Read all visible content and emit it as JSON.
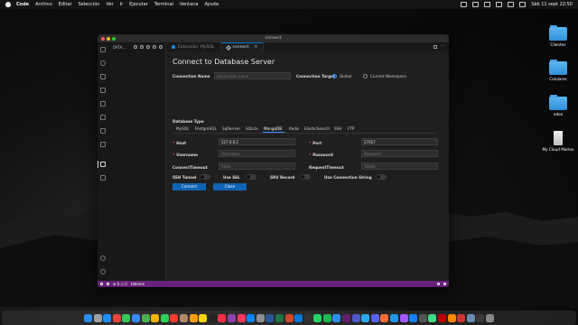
{
  "menubar": {
    "app": "Code",
    "items": [
      "Archivo",
      "Editar",
      "Selección",
      "Ver",
      "Ir",
      "Ejecutar",
      "Terminal",
      "Ventana",
      "Ayuda"
    ],
    "clock": "Sáb 11 sept 22:50"
  },
  "desktop": {
    "icons": [
      "Clientes",
      "Celulares",
      "odoo",
      "My Cloud Marlon"
    ]
  },
  "window": {
    "title": "connect",
    "sidebar_title": "DATA...",
    "tabs": [
      {
        "label": "Extensión: MySQL",
        "active": false
      },
      {
        "label": "connect",
        "active": true
      }
    ]
  },
  "form": {
    "title": "Connect to Database Server",
    "connection_name_label": "Connection Name",
    "connection_name_placeholder": "Connection name",
    "connection_target_label": "Connection Target",
    "target_options": [
      {
        "label": "Global",
        "selected": true
      },
      {
        "label": "Current Workspace",
        "selected": false
      }
    ],
    "database_type_label": "Database Type",
    "db_types": [
      "MySQL",
      "PostgreSQL",
      "SqlServer",
      "SQLite",
      "MongoDB",
      "Redis",
      "ElasticSearch",
      "SSH",
      "FTP"
    ],
    "active_db_type": "MongoDB",
    "host_label": "Host",
    "host_value": "127.0.0.1",
    "port_label": "Port",
    "port_value": "27017",
    "username_label": "Username",
    "username_placeholder": "Username",
    "password_label": "Password",
    "password_placeholder": "Password",
    "connect_timeout_label": "ConnectTimeout",
    "connect_timeout_placeholder": "5000",
    "request_timeout_label": "RequestTimeout",
    "request_timeout_placeholder": "10000",
    "ssh_tunnel_label": "SSH Tunnel",
    "use_ssl_label": "Use SSL",
    "srv_record_label": "SRV Record",
    "use_connection_string_label": "Use Connection String",
    "connect_button": "Connect",
    "close_button": "Close"
  },
  "statusbar": {
    "problems": "⊗ 0 ⚠ 0",
    "tabnine": "tabnine"
  },
  "colors": {
    "accent": "#0e63b4",
    "statusbar": "#68217a",
    "required": "#f14c4c"
  },
  "dock": {
    "apps": [
      "finder",
      "launchpad",
      "safari",
      "chrome",
      "messages",
      "mail",
      "maps",
      "photos",
      "facetime",
      "calendar",
      "contacts",
      "reminders",
      "notes",
      "tv",
      "music",
      "podcasts",
      "news",
      "appstore",
      "settings",
      "word",
      "excel",
      "powerpoint",
      "vscode",
      "terminal",
      "whatsapp",
      "spotify",
      "zoom",
      "slack",
      "teams",
      "telegram",
      "discord",
      "postman",
      "docker",
      "figma",
      "xcode",
      "simulator",
      "android-studio",
      "filezilla",
      "vlc",
      "transmission",
      "preview",
      "activity-monitor",
      "trash"
    ]
  }
}
